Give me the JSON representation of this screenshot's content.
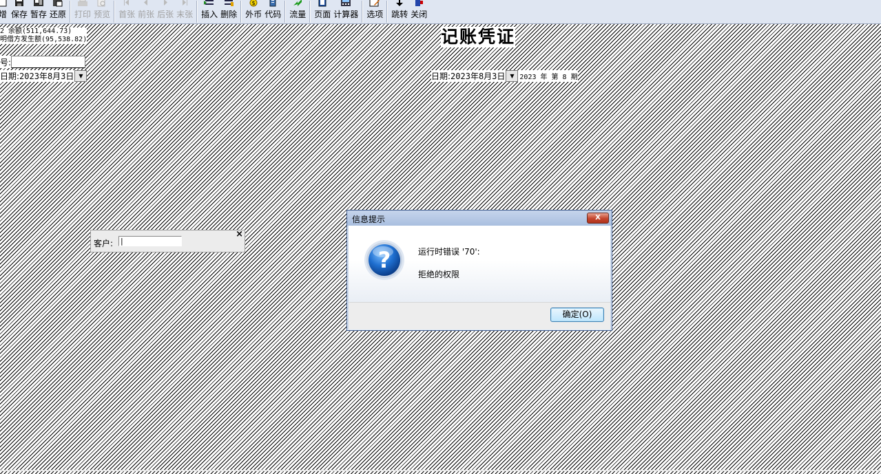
{
  "toolbar": {
    "buttons": [
      {
        "label": "增",
        "icon": "new-icon",
        "enabled": true
      },
      {
        "label": "保存",
        "icon": "save-icon",
        "enabled": true
      },
      {
        "label": "暂存",
        "icon": "stash-icon",
        "enabled": true
      },
      {
        "label": "还原",
        "icon": "restore-icon",
        "enabled": true
      },
      {
        "label": "打印",
        "icon": "print-icon",
        "enabled": false
      },
      {
        "label": "预览",
        "icon": "preview-icon",
        "enabled": false
      },
      {
        "label": "首张",
        "icon": "first-icon",
        "enabled": false
      },
      {
        "label": "前张",
        "icon": "prev-icon",
        "enabled": false
      },
      {
        "label": "后张",
        "icon": "next-icon",
        "enabled": false
      },
      {
        "label": "末张",
        "icon": "last-icon",
        "enabled": false
      },
      {
        "label": "插入",
        "icon": "insert-icon",
        "enabled": true
      },
      {
        "label": "删除",
        "icon": "delete-icon",
        "enabled": true
      },
      {
        "label": "外币",
        "icon": "currency-icon",
        "enabled": true
      },
      {
        "label": "代码",
        "icon": "code-icon",
        "enabled": true
      },
      {
        "label": "流量",
        "icon": "flow-icon",
        "enabled": true
      },
      {
        "label": "页面",
        "icon": "page-icon",
        "enabled": true
      },
      {
        "label": "计算器",
        "icon": "calculator-icon",
        "enabled": true
      },
      {
        "label": "选项",
        "icon": "options-icon",
        "enabled": true
      },
      {
        "label": "跳转",
        "icon": "jump-icon",
        "enabled": true
      },
      {
        "label": "关闭",
        "icon": "close-icon",
        "enabled": true
      }
    ]
  },
  "info": {
    "line1": "2 余额(511,644.73)",
    "line2": "明借方发生额(95,538.82)"
  },
  "voucher": {
    "title": "记账凭证",
    "number_label": "号:",
    "left_date_label": "日期:",
    "left_date_value": "2023年8月3日",
    "right_date_label": "日期:",
    "right_date_value": "2023年8月3日",
    "period_text": "2023 年 第 8 期"
  },
  "customer_popup": {
    "label": "客户:",
    "value": "|",
    "close": "×"
  },
  "dialog": {
    "title": "信息提示",
    "close": "X",
    "message_line1": "运行时错误 '70':",
    "message_line2": "拒绝的权限",
    "ok_label": "确定(O)"
  },
  "colors": {
    "toolbar_bg": "#dfe6f2",
    "dialog_border": "#3d5a8c",
    "close_red": "#c4452d",
    "question_blue": "#1f6fd0"
  }
}
